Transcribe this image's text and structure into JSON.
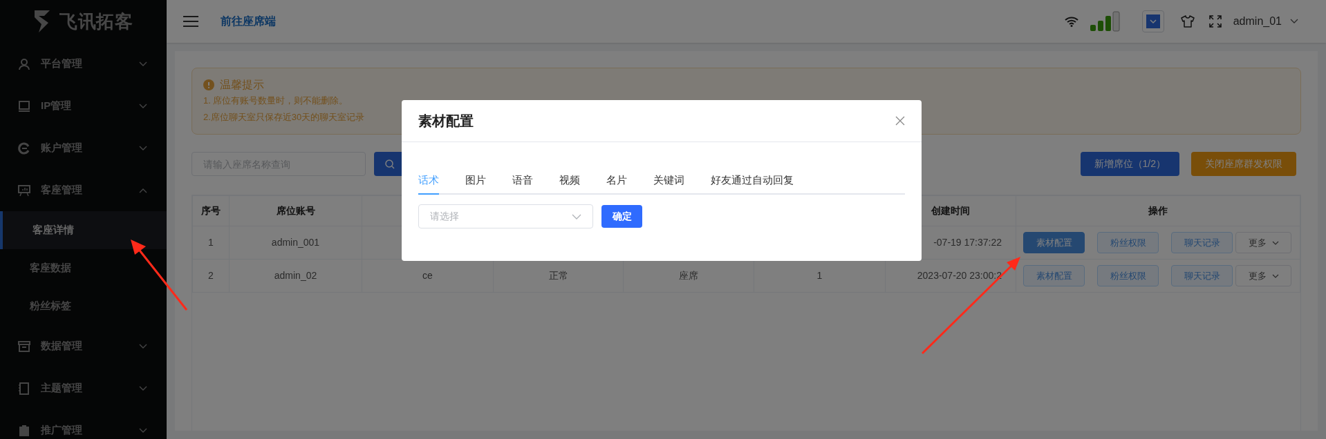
{
  "sidebar": {
    "logo": "飞讯拓客",
    "items": [
      {
        "label": "平台管理",
        "expanded": false
      },
      {
        "label": "IP管理",
        "expanded": false
      },
      {
        "label": "账户管理",
        "expanded": false
      },
      {
        "label": "客座管理",
        "expanded": true,
        "children": [
          {
            "label": "客座详情",
            "selected": true
          },
          {
            "label": "客座数据",
            "selected": false
          },
          {
            "label": "粉丝标签",
            "selected": false
          }
        ]
      },
      {
        "label": "数据管理",
        "expanded": false
      },
      {
        "label": "主题管理",
        "expanded": false
      },
      {
        "label": "推广管理",
        "expanded": false
      }
    ]
  },
  "header": {
    "link": "前往座席端",
    "user": "admin_01"
  },
  "notice": {
    "title": "温馨提示",
    "lines": [
      "1. 席位有账号数量时，则不能删除。",
      "2.席位聊天室只保存近30天的聊天室记录"
    ]
  },
  "toolbar": {
    "search": {
      "placeholder": "请输入座席名称查询"
    },
    "buttons": [
      {
        "label": "新增席位（1/2）",
        "kind": "primary"
      },
      {
        "label": "关闭座席群发权限",
        "kind": "warning"
      }
    ]
  },
  "table": {
    "columns": [
      "序号",
      "席位账号",
      null,
      null,
      null,
      null,
      "创建时间",
      "操作"
    ],
    "rows": [
      {
        "cells": [
          "1",
          "admin_001",
          null,
          null,
          null,
          null,
          "-07-19 17:37:22"
        ],
        "actions": [
          {
            "label": "素材配置",
            "kind": "plain",
            "active": true
          },
          {
            "label": "粉丝权限",
            "kind": "plain",
            "active": false
          },
          {
            "label": "聊天记录",
            "kind": "plain",
            "active": false
          },
          {
            "label": "更多",
            "kind": "dropdown"
          }
        ]
      },
      {
        "cells": [
          "2",
          "admin_02",
          "ce",
          "正常",
          "座席",
          "1",
          "2023-07-20 23:00:2"
        ],
        "actions": [
          {
            "label": "素材配置",
            "kind": "plain",
            "active": false
          },
          {
            "label": "粉丝权限",
            "kind": "plain",
            "active": false
          },
          {
            "label": "聊天记录",
            "kind": "plain",
            "active": false
          },
          {
            "label": "更多",
            "kind": "dropdown"
          }
        ]
      }
    ]
  },
  "dialog": {
    "title": "素材配置",
    "tabs": [
      {
        "label": "话术",
        "selected": true
      },
      {
        "label": "图片",
        "selected": false
      },
      {
        "label": "语音",
        "selected": false
      },
      {
        "label": "视频",
        "selected": false
      },
      {
        "label": "名片",
        "selected": false
      },
      {
        "label": "关键词",
        "selected": false
      },
      {
        "label": "好友通过自动回复",
        "selected": false
      }
    ],
    "select": {
      "placeholder": "请选择"
    },
    "confirm": "确定"
  }
}
